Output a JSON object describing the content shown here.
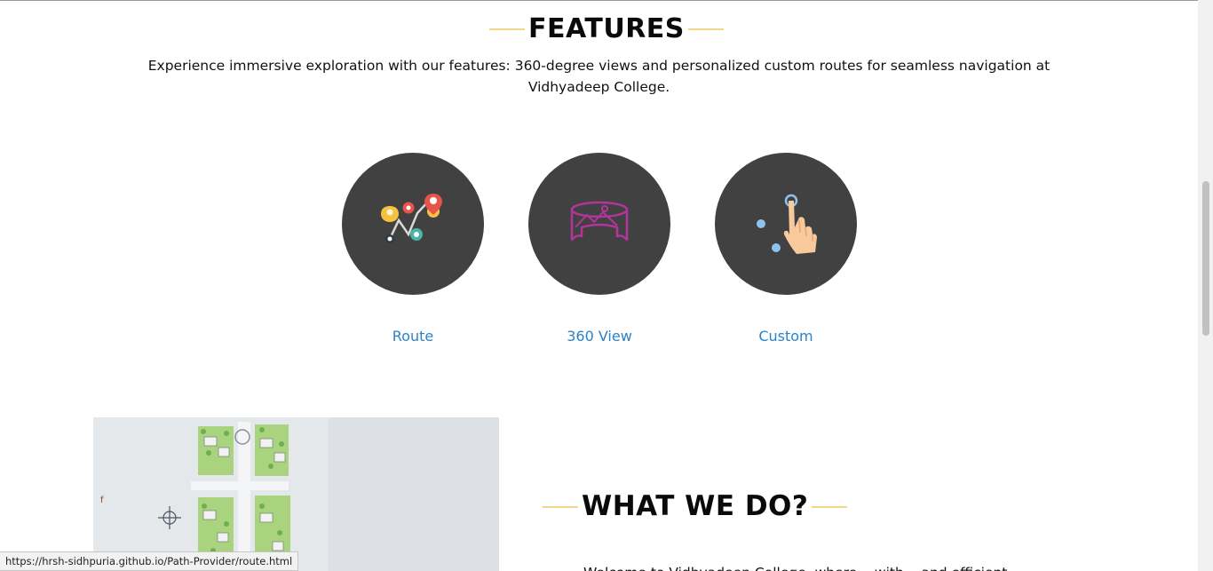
{
  "features": {
    "heading": "FEATURES",
    "description": "Experience immersive exploration with our features: 360-degree views and personalized custom routes for seamless navigation at Vidhyadeep College.",
    "items": [
      {
        "label": "Route",
        "icon": "route-pins-icon"
      },
      {
        "label": "360 View",
        "icon": "panorama-360-icon"
      },
      {
        "label": "Custom",
        "icon": "touch-hand-icon"
      }
    ]
  },
  "what_we_do": {
    "heading": "WHAT WE DO?",
    "paragraph_peek": "Welcome to Vidhyadeep College, where... with ...and efficient"
  },
  "status_bar": {
    "url": "https://hrsh-sidhpuria.github.io/Path-Provider/route.html"
  },
  "colors": {
    "accent_rule": "#f3d789",
    "circle_bg": "#414141",
    "link": "#2a83c9"
  }
}
